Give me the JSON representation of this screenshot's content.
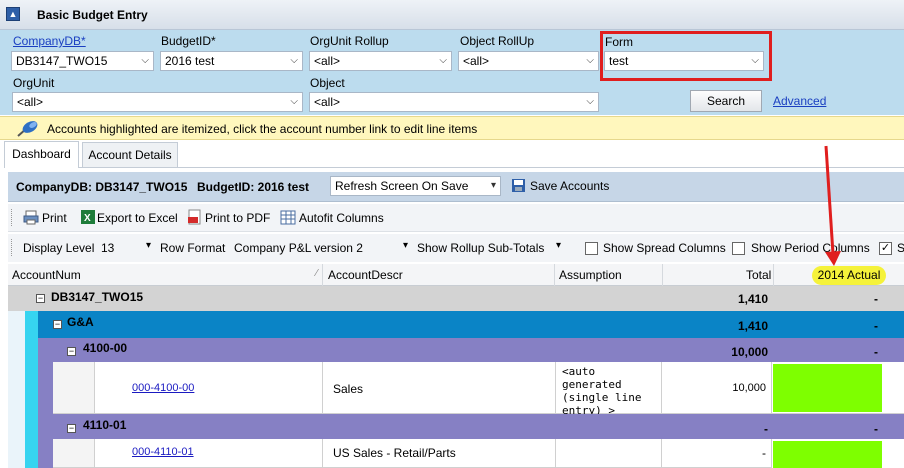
{
  "title": "Basic Budget Entry",
  "filters": {
    "company_label": "CompanyDB*",
    "company_value": "DB3147_TWO15",
    "budget_label": "BudgetID*",
    "budget_value": "2016 test",
    "orgrollup_label": "OrgUnit Rollup",
    "orgrollup_value": "<all>",
    "objrollup_label": "Object RollUp",
    "objrollup_value": "<all>",
    "form_label": "Form",
    "form_value": "test",
    "orgunit_label": "OrgUnit",
    "orgunit_value": "<all>",
    "object_label": "Object",
    "object_value": "<all>",
    "search_label": "Search",
    "advanced_label": "Advanced"
  },
  "info": "Accounts highlighted are itemized, click the account number link to edit line items",
  "tabs": [
    "Dashboard",
    "Account Details"
  ],
  "summary": {
    "company": "CompanyDB: DB3147_TWO15",
    "budget": "BudgetID: 2016 test",
    "refresh_option": "Refresh Screen On Save",
    "save_label": "Save Accounts"
  },
  "toolbar": {
    "print": "Print",
    "export": "Export to Excel",
    "pdf": "Print to PDF",
    "autofit": "Autofit Columns",
    "display_level_label": "Display Level",
    "display_level_value": "13",
    "row_format_label": "Row Format",
    "row_format_value": "Company P&L version 2",
    "rollup_label": "Show Rollup Sub-Totals",
    "spread_label": "Show Spread Columns",
    "period_label": "Show Period Columns",
    "s_label": "S"
  },
  "grid": {
    "headers": [
      "AccountNum",
      "AccountDescr",
      "Assumption",
      "Total",
      "2014 Actual"
    ],
    "rows": [
      {
        "label": "DB3147_TWO15",
        "total": "1,410",
        "actual": "-"
      },
      {
        "label": "G&A",
        "total": "1,410",
        "actual": "-"
      },
      {
        "label": "4100-00",
        "total": "10,000",
        "actual": "-"
      },
      {
        "account": "000-4100-00",
        "descr": "Sales",
        "assumption": "<auto generated (single line entry) >",
        "total": "10,000"
      },
      {
        "label": "4110-01",
        "total": "-",
        "actual": "-"
      },
      {
        "account": "000-4110-01",
        "descr": "US Sales - Retail/Parts",
        "total": "-"
      }
    ]
  },
  "colors": {
    "highlight_box": "#e01e1e",
    "level1": "#0a84c6",
    "level2": "#8680c4",
    "itemized": "#7eff00",
    "annotation": "#f5f23a"
  }
}
